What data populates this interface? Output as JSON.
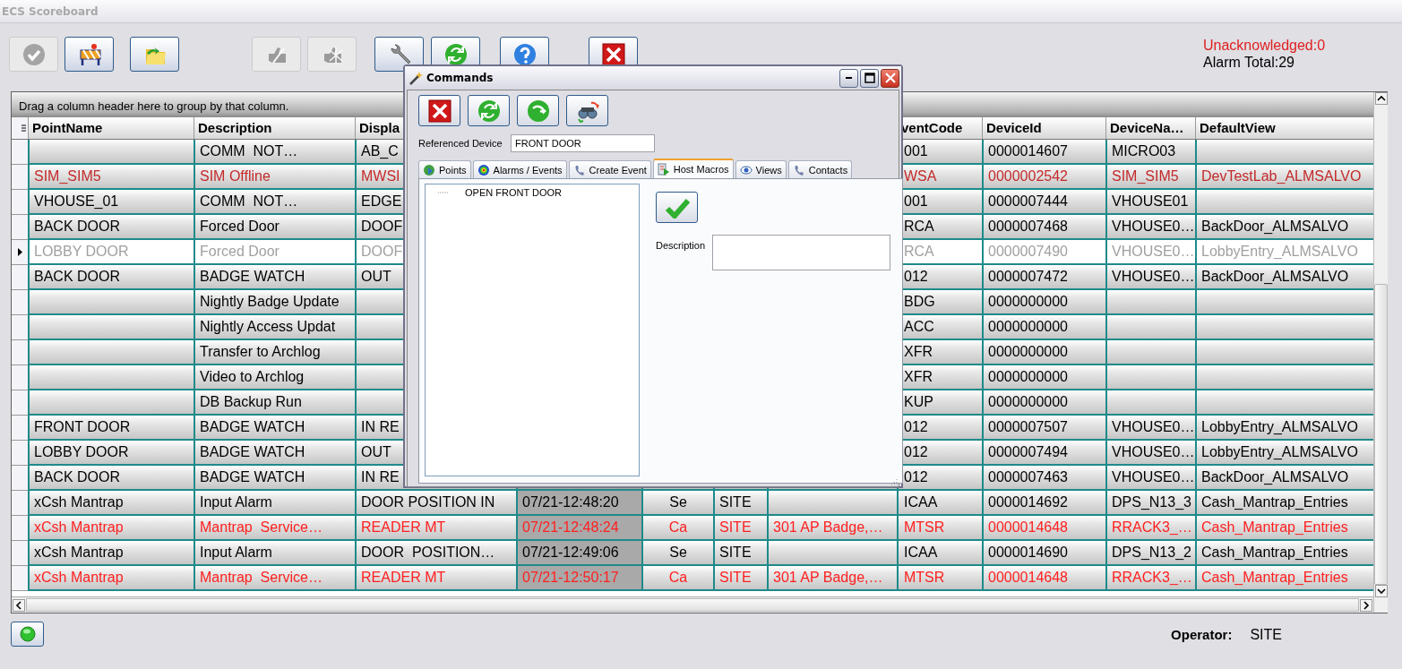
{
  "window": {
    "title": "ECS Scoreboard"
  },
  "toolbar": [
    {
      "disabled": true
    },
    {
      "disabled": false
    },
    {
      "disabled": false
    },
    {
      "disabled": true
    },
    {
      "disabled": true
    },
    {
      "disabled": false
    },
    {
      "disabled": false
    },
    {
      "disabled": false
    },
    {
      "disabled": false
    }
  ],
  "alarm_summary": {
    "unacknowledged": "Unacknowledged:0",
    "total": "Alarm Total:29"
  },
  "table": {
    "group_hint": "Drag a column header here to group by that column.",
    "columns": [
      "PointName",
      "Description",
      "Displa",
      null,
      null,
      null,
      null,
      "ventCode",
      "DeviceId",
      "DeviceNa…",
      "DefaultView"
    ],
    "rows": [
      {
        "selected": false,
        "color": "#000000",
        "cells": [
          null,
          "COMM  NOT…",
          "AB_C",
          null,
          null,
          null,
          null,
          "001",
          "0000014607",
          "MICRO03",
          null
        ]
      },
      {
        "selected": false,
        "color": "#c42a2a",
        "cells": [
          "SIM_SIM5",
          "SIM Offline",
          "MWSI",
          null,
          null,
          null,
          null,
          "WSA",
          "0000002542",
          "SIM_SIM5",
          "DevTestLab_ALMSALVO"
        ]
      },
      {
        "selected": false,
        "color": "#000000",
        "cells": [
          "VHOUSE_01",
          "COMM  NOT…",
          "EDGE",
          null,
          null,
          null,
          null,
          "001",
          "0000007444",
          "VHOUSE01",
          null
        ]
      },
      {
        "selected": false,
        "color": "#000000",
        "cells": [
          "BACK DOOR",
          "Forced Door",
          "DOOF",
          null,
          null,
          null,
          null,
          "RCA",
          "0000007468",
          "VHOUSE0…",
          "BackDoor_ALMSALVO"
        ]
      },
      {
        "selected": true,
        "color": "#a0a0a0",
        "cells": [
          "LOBBY DOOR",
          "Forced Door",
          "DOOF",
          null,
          null,
          null,
          null,
          "RCA",
          "0000007490",
          "VHOUSE0…",
          "LobbyEntry_ALMSALVO"
        ]
      },
      {
        "selected": false,
        "color": "#000000",
        "cells": [
          "BACK DOOR",
          "BADGE WATCH",
          "OUT",
          null,
          null,
          null,
          null,
          "012",
          "0000007472",
          "VHOUSE0…",
          "BackDoor_ALMSALVO"
        ]
      },
      {
        "selected": false,
        "color": "#000000",
        "cells": [
          null,
          "Nightly Badge Update",
          null,
          null,
          null,
          null,
          null,
          "BDG",
          "0000000000",
          null,
          null
        ]
      },
      {
        "selected": false,
        "color": "#000000",
        "cells": [
          null,
          "Nightly Access Updat",
          null,
          null,
          null,
          null,
          null,
          "ACC",
          "0000000000",
          null,
          null
        ]
      },
      {
        "selected": false,
        "color": "#000000",
        "cells": [
          null,
          "Transfer to Archlog",
          null,
          null,
          null,
          null,
          null,
          "XFR",
          "0000000000",
          null,
          null
        ]
      },
      {
        "selected": false,
        "color": "#000000",
        "cells": [
          null,
          "Video to Archlog",
          null,
          null,
          null,
          null,
          null,
          "XFR",
          "0000000000",
          null,
          null
        ]
      },
      {
        "selected": false,
        "color": "#000000",
        "cells": [
          null,
          "DB Backup Run",
          null,
          null,
          null,
          null,
          null,
          "KUP",
          "0000000000",
          null,
          null
        ]
      },
      {
        "selected": false,
        "color": "#000000",
        "cells": [
          "FRONT DOOR",
          "BADGE WATCH",
          "IN RE",
          null,
          null,
          null,
          null,
          "012",
          "0000007507",
          "VHOUSE0…",
          "LobbyEntry_ALMSALVO"
        ]
      },
      {
        "selected": false,
        "color": "#000000",
        "cells": [
          "LOBBY DOOR",
          "BADGE WATCH",
          "OUT",
          null,
          null,
          null,
          null,
          "012",
          "0000007494",
          "VHOUSE0…",
          "LobbyEntry_ALMSALVO"
        ]
      },
      {
        "selected": false,
        "color": "#000000",
        "cells": [
          "BACK DOOR",
          "BADGE WATCH",
          "IN RE",
          null,
          null,
          null,
          null,
          "012",
          "0000007463",
          "VHOUSE0…",
          "BackDoor_ALMSALVO"
        ]
      },
      {
        "selected": false,
        "color": "#000000",
        "cells": [
          "xCsh Mantrap",
          "Input Alarm",
          "DOOR POSITION IN",
          "07/21-12:48:20",
          "Se",
          "SITE",
          null,
          "ICAA",
          "0000014692",
          "DPS_N13_3",
          "Cash_Mantrap_Entries"
        ]
      },
      {
        "selected": false,
        "color": "#ff2020",
        "cells": [
          "xCsh Mantrap",
          "Mantrap  Service…",
          "READER MT",
          "07/21-12:48:24",
          "Ca",
          "SITE",
          "301 AP Badge,…",
          "MTSR",
          "0000014648",
          "RRACK3_…",
          "Cash_Mantrap_Entries"
        ]
      },
      {
        "selected": false,
        "color": "#000000",
        "cells": [
          "xCsh Mantrap",
          "Input Alarm",
          "DOOR  POSITION…",
          "07/21-12:49:06",
          "Se",
          "SITE",
          null,
          "ICAA",
          "0000014690",
          "DPS_N13_2",
          "Cash_Mantrap_Entries"
        ]
      },
      {
        "selected": false,
        "color": "#ff2020",
        "cells": [
          "xCsh Mantrap",
          "Mantrap  Service…",
          "READER MT",
          "07/21-12:50:17",
          "Ca",
          "SITE",
          "301 AP Badge,…",
          "MTSR",
          "0000014648",
          "RRACK3_…",
          "Cash_Mantrap_Entries"
        ]
      }
    ]
  },
  "status_bar": {
    "operator_label": "Operator:",
    "operator": "SITE"
  },
  "dialog": {
    "title": "Commands",
    "referenced_device": {
      "label": "Referenced Device",
      "value": "FRONT DOOR"
    },
    "tabs": [
      {
        "label": "Points",
        "selected": false
      },
      {
        "label": "Alarms / Events",
        "selected": false
      },
      {
        "label": "Create Event",
        "selected": false
      },
      {
        "label": "Host Macros",
        "selected": true
      },
      {
        "label": "Views",
        "selected": false
      },
      {
        "label": "Contacts",
        "selected": false
      }
    ],
    "macros": [
      {
        "label": "OPEN FRONT DOOR"
      }
    ],
    "description": {
      "label": "Description"
    }
  }
}
